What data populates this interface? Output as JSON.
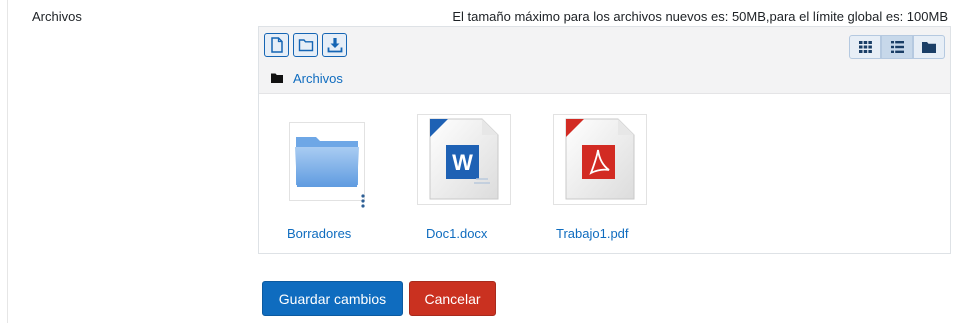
{
  "field": {
    "label": "Archivos",
    "max_size_text": "El tamaño máximo para los archivos nuevos es: 50MB,para el límite global es: 100MB"
  },
  "toolbar": {
    "left_buttons": [
      "new-file-icon",
      "folder-icon",
      "download-icon"
    ],
    "view_buttons": [
      "grid-view-icon",
      "list-view-icon",
      "folder-tree-icon"
    ],
    "active_view": "list-view-icon"
  },
  "path": {
    "label": "Archivos"
  },
  "files": [
    {
      "name": "Borradores",
      "type": "folder"
    },
    {
      "name": "Doc1.docx",
      "type": "word"
    },
    {
      "name": "Trabajo1.pdf",
      "type": "pdf"
    }
  ],
  "actions": {
    "save_label": "Guardar cambios",
    "cancel_label": "Cancelar"
  },
  "colors": {
    "accent": "#0f6cbf",
    "danger": "#ca3120",
    "word": "#1e61b4",
    "pdf": "#d22b23"
  }
}
